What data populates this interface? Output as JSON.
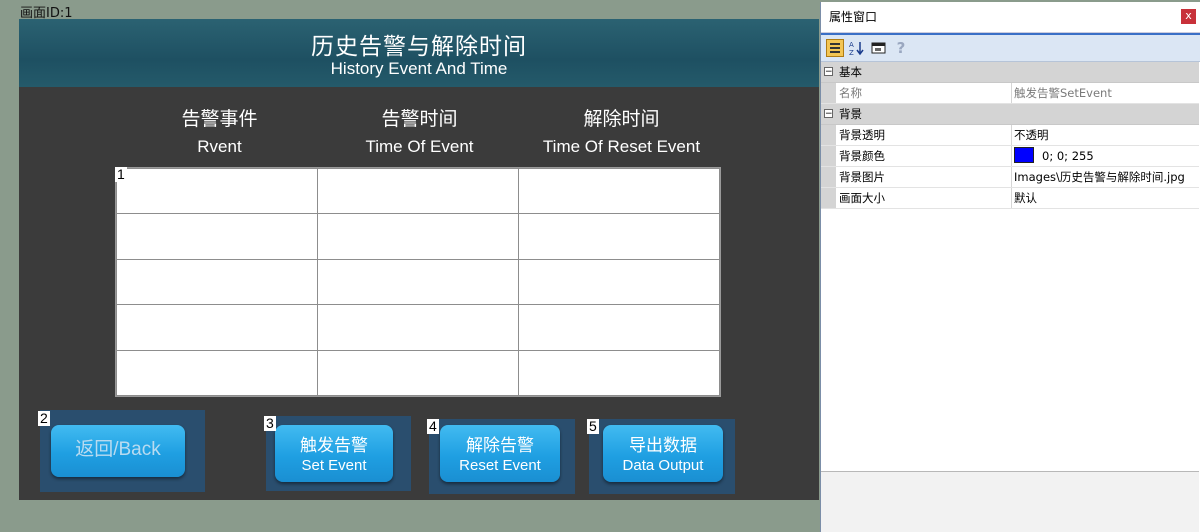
{
  "page_label": "画面ID:1",
  "canvas": {
    "title_cn": "历史告警与解除时间",
    "title_en": "History Event And Time",
    "columns": [
      {
        "cn": "告警事件",
        "en": "Rvent"
      },
      {
        "cn": "告警时间",
        "en": "Time Of Event"
      },
      {
        "cn": "解除时间",
        "en": "Time Of Reset Event"
      }
    ],
    "markers": [
      "1",
      "2",
      "3",
      "4",
      "5"
    ],
    "buttons": {
      "back": "返回/Back",
      "set_cn": "触发告警",
      "set_en": "Set Event",
      "reset_cn": "解除告警",
      "reset_en": "Reset Event",
      "export_cn": "导出数据",
      "export_en": "Data Output"
    }
  },
  "property_window": {
    "title": "属性窗口",
    "close": "x",
    "toolbar": {
      "help": "?"
    },
    "category_basic": "基本",
    "category_background": "背景",
    "rows": [
      {
        "key": "名称",
        "value": "触发告警SetEvent"
      },
      {
        "key": "背景透明",
        "value": "不透明"
      },
      {
        "key": "背景颜色",
        "value": "0; 0; 255"
      },
      {
        "key": "背景图片",
        "value": "Images\\历史告警与解除时间.jpg"
      },
      {
        "key": "画面大小",
        "value": "默认"
      }
    ],
    "swatch_color": "#0000ff"
  },
  "colors": {
    "canvas_bg": "#3b3b3b",
    "header_bg": "#1e5062",
    "button_blue": "#1f9fe2",
    "button_frame": "#2a4e6e"
  }
}
